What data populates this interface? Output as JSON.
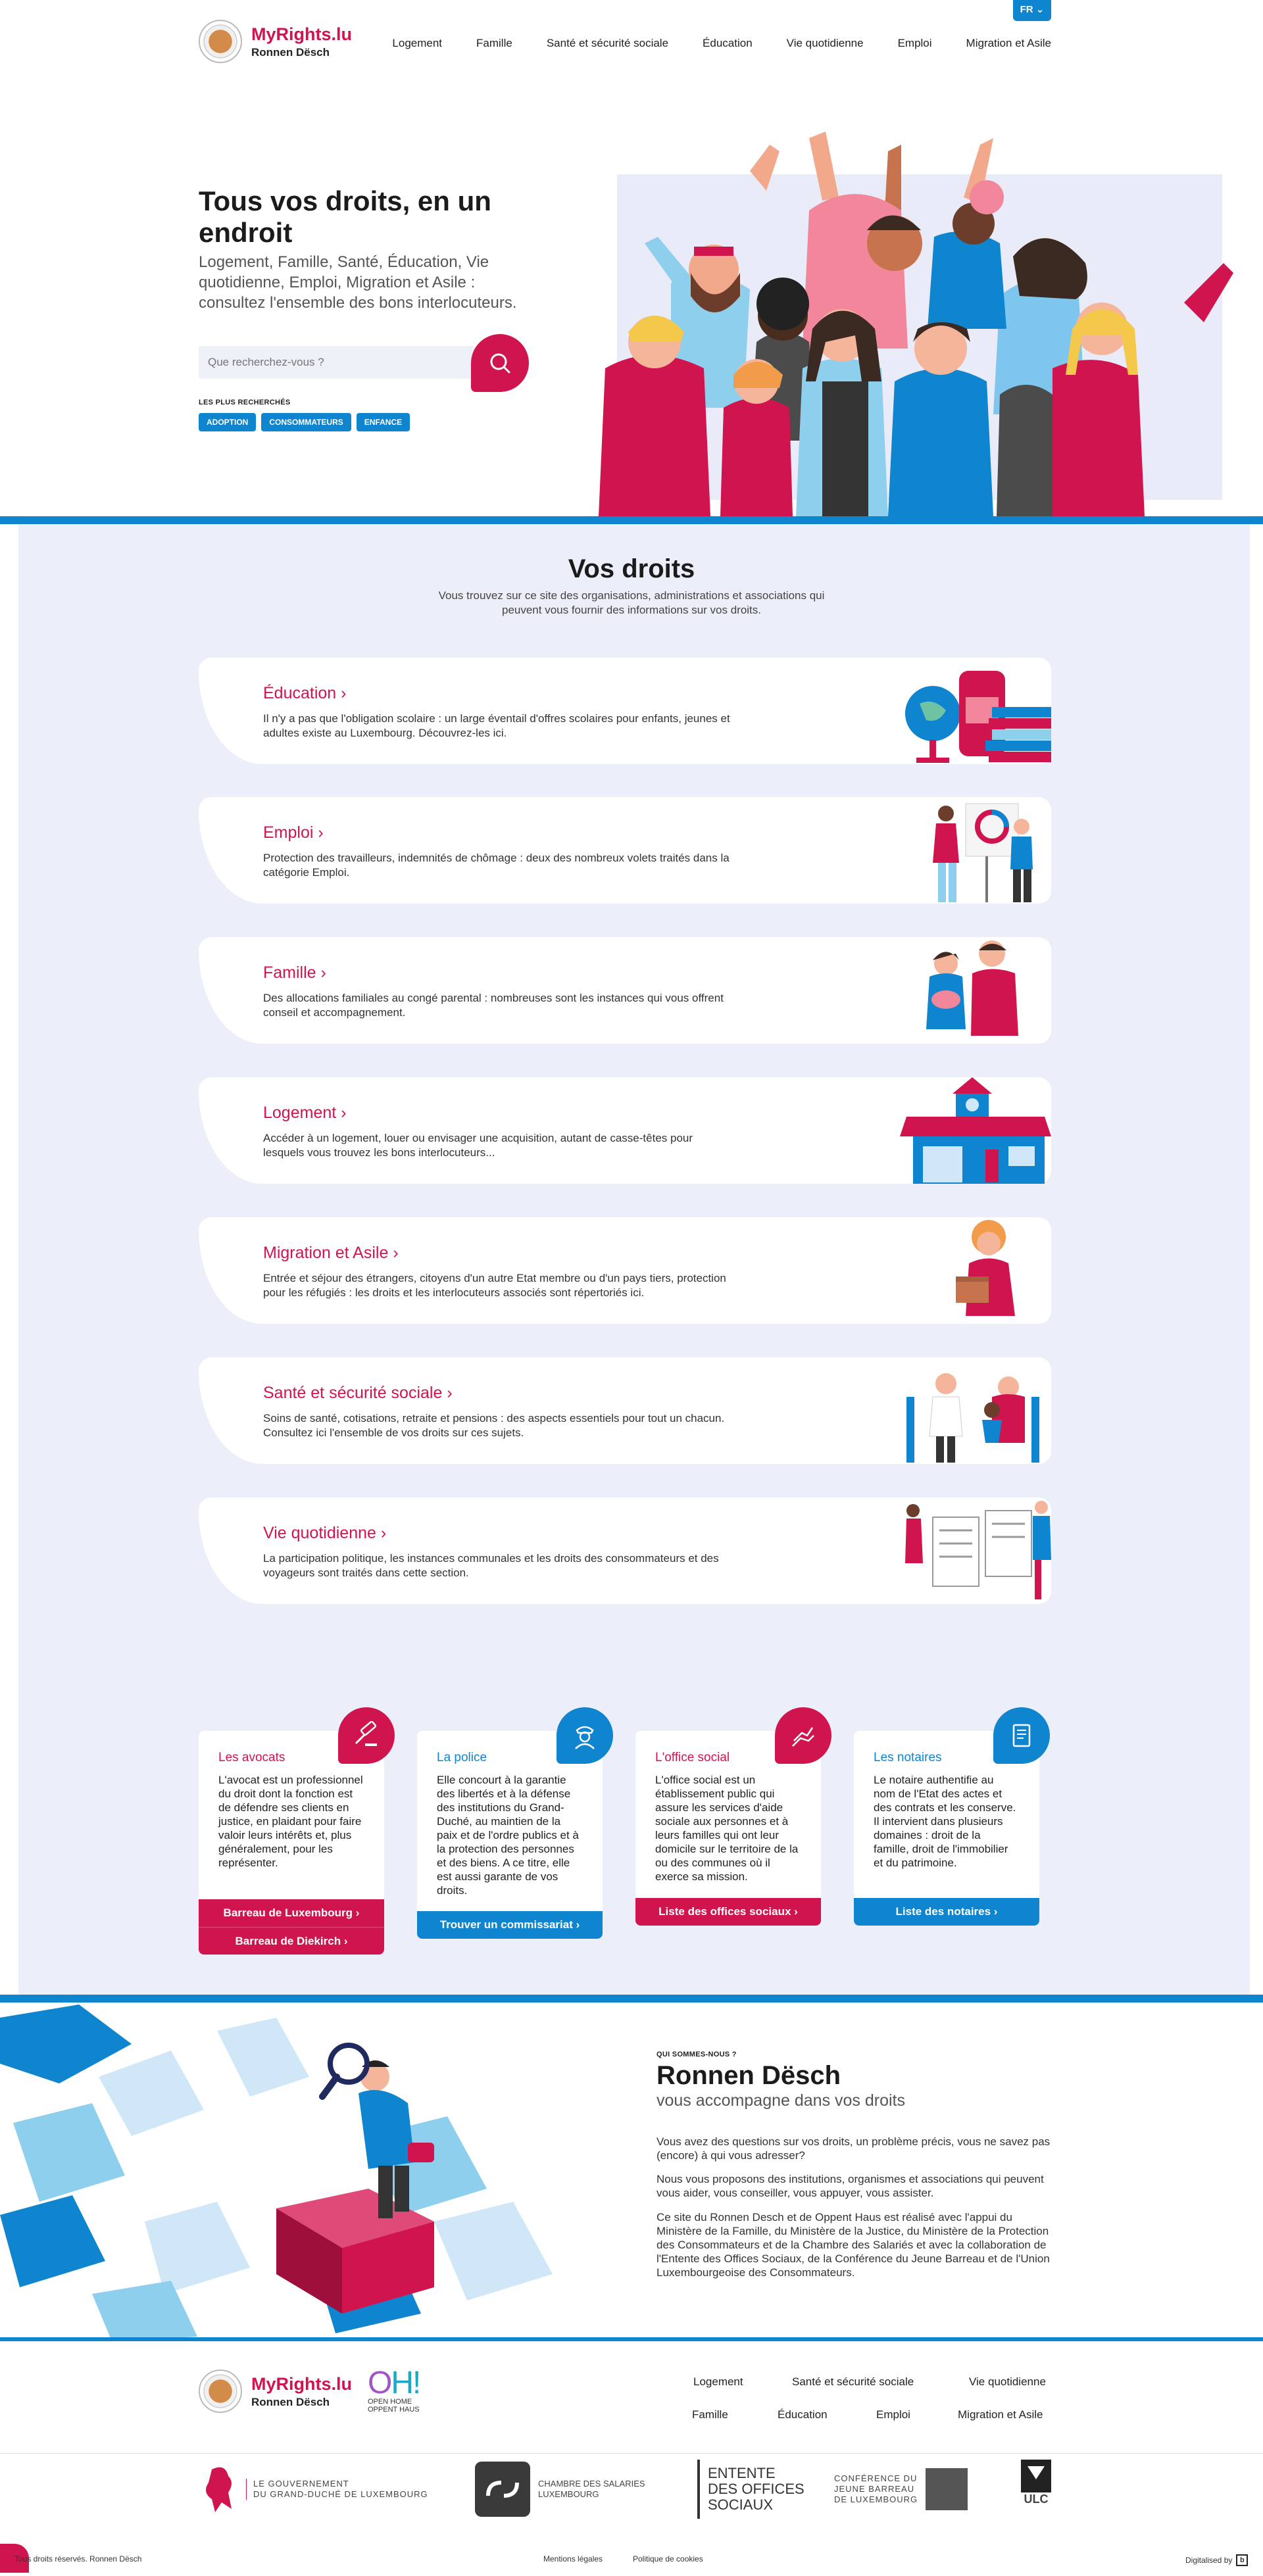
{
  "header": {
    "logo_name": "MyRights.lu",
    "logo_sub": "Ronnen Dësch",
    "lang": "FR",
    "nav": [
      "Logement",
      "Famille",
      "Santé et sécurité sociale",
      "Éducation",
      "Vie quotidienne",
      "Emploi",
      "Migration et Asile"
    ]
  },
  "hero": {
    "title": "Tous vos droits, en un endroit",
    "subtitle": "Logement, Famille, Santé, Éducation, Vie quotidienne, Emploi, Migration et Asile : consultez l'ensemble des bons interlocuteurs.",
    "search_placeholder": "Que recherchez-vous ?",
    "popular_label": "LES PLUS RECHERCHÉS",
    "tags": [
      "ADOPTION",
      "CONSOMMATEURS",
      "ENFANCE"
    ]
  },
  "rights": {
    "title": "Vos droits",
    "intro": "Vous trouvez sur ce site des organisations, administrations et associations qui peuvent vous fournir des informations sur vos droits.",
    "cards": [
      {
        "title": "Éducation",
        "desc": "Il n'y a pas que l'obligation scolaire : un large éventail d'offres scolaires pour enfants, jeunes et adultes existe au Luxembourg. Découvrez-les ici."
      },
      {
        "title": "Emploi",
        "desc": "Protection des travailleurs, indemnités de chômage : deux des nombreux volets traités dans la catégorie Emploi."
      },
      {
        "title": "Famille",
        "desc": "Des allocations familiales au congé parental : nombreuses sont les instances qui vous offrent conseil et accompagnement."
      },
      {
        "title": "Logement",
        "desc": "Accéder à un logement, louer ou envisager une acquisition, autant de casse-têtes pour lesquels vous trouvez les bons interlocuteurs..."
      },
      {
        "title": "Migration et Asile",
        "desc": "Entrée et séjour des étrangers, citoyens d'un autre Etat membre ou d'un pays tiers, protection pour les réfugiés : les droits et les interlocuteurs associés sont répertoriés ici."
      },
      {
        "title": "Santé et sécurité sociale",
        "desc": "Soins de santé, cotisations, retraite et pensions : des aspects essentiels pour tout un chacun. Consultez ici l'ensemble de vos droits sur ces sujets."
      },
      {
        "title": "Vie quotidienne",
        "desc": "La participation politique, les instances communales et les droits des consommateurs et des voyageurs sont traités dans cette section."
      }
    ]
  },
  "pros": [
    {
      "title": "Les avocats",
      "desc": "L'avocat est un professionnel du droit dont la fonction est de défendre ses clients en justice, en plaidant pour faire valoir leurs intérêts et, plus généralement, pour les représenter.",
      "buttons": [
        "Barreau de Luxembourg",
        "Barreau de Diekirch"
      ],
      "color": "#d0154e",
      "icon": "gavel-icon"
    },
    {
      "title": "La police",
      "desc": "Elle concourt à la garantie des libertés et à la défense des institutions du Grand-Duché, au maintien de la paix et de l'ordre publics et à la protection des personnes et des biens. A ce titre, elle est aussi garante de vos droits.",
      "buttons": [
        "Trouver un commissariat"
      ],
      "color": "#0f84cf",
      "icon": "police-officer-icon"
    },
    {
      "title": "L'office social",
      "desc": "L'office social est un établissement public qui assure les services d'aide sociale aux personnes et à leurs familles qui ont leur domicile sur le territoire de la ou des communes où il exerce sa mission.",
      "buttons": [
        "Liste des offices sociaux"
      ],
      "color": "#d0154e",
      "icon": "helping-hand-icon"
    },
    {
      "title": "Les notaires",
      "desc": "Le notaire authentifie au nom de l'Etat des actes et des contrats et les conserve. Il intervient dans plusieurs domaines : droit de la famille, droit de l'immobilier et du patrimoine.",
      "buttons": [
        "Liste des notaires"
      ],
      "color": "#0f84cf",
      "icon": "document-icon"
    }
  ],
  "about": {
    "small": "QUI SOMMES-NOUS ?",
    "title": "Ronnen Dësch",
    "subtitle": "vous accompagne dans vos droits",
    "p1": "Vous avez des questions sur vos droits, un problème précis, vous ne savez pas (encore) à qui vous adresser?",
    "p2": "Nous vous proposons des institutions, organismes et associations qui peuvent vous aider, vous conseiller, vous appuyer, vous assister.",
    "p3": "Ce site du Ronnen Desch et de Oppent Haus est réalisé avec l'appui du Ministère de la Famille, du Ministère de la Justice, du Ministère de la Protection des Consommateurs et de la Chambre des Salariés et avec la collaboration de l'Entente des Offices Sociaux, de la Conférence du Jeune Barreau et de l'Union Luxembourgeoise des Consommateurs."
  },
  "footer": {
    "openhome_l1": "OPEN HOME",
    "openhome_l2": "OPPENT HAUS",
    "nav_row1": [
      "Logement",
      "Santé et sécurité sociale",
      "Vie quotidienne"
    ],
    "nav_row2": [
      "Famille",
      "Éducation",
      "Emploi",
      "Migration et Asile"
    ],
    "partners": {
      "gov_l1": "LE GOUVERNEMENT",
      "gov_l2": "DU GRAND-DUCHÉ DE LUXEMBOURG",
      "csl_l1": "CHAMBRE DES SALARIES",
      "csl_l2": "LUXEMBOURG",
      "eos_l1": "ENTENTE",
      "eos_l2": "DES OFFICES",
      "eos_l3": "SOCIAUX",
      "cjb_l1": "CONFÉRENCE DU",
      "cjb_l2": "JEUNE BARREAU",
      "cjb_l3": "DE LUXEMBOURG",
      "ulc": "ULC"
    },
    "copyright": "Tous droits réservés. Ronnen Dësch",
    "legal": "Mentions légales",
    "cookies": "Politique de cookies",
    "credit": "Digitalised by"
  },
  "colors": {
    "brand_red": "#d0154e",
    "brand_blue": "#0f84cf",
    "section_bg": "#eceefa"
  }
}
